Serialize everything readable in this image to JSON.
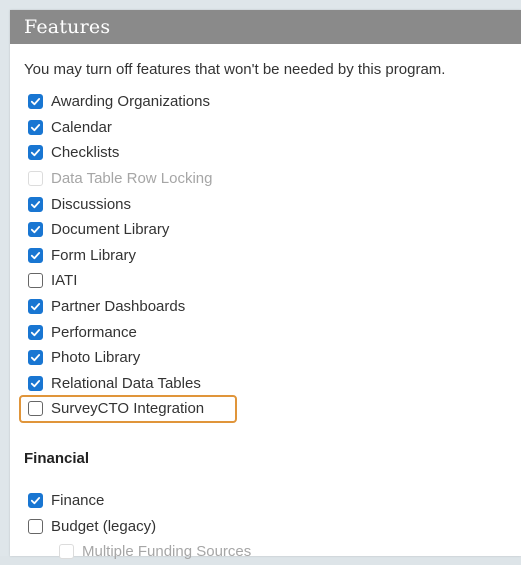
{
  "panel": {
    "title": "Features",
    "intro": "You may turn off features that won't be needed by this program."
  },
  "features": [
    {
      "label": "Awarding Organizations",
      "state": "checked"
    },
    {
      "label": "Calendar",
      "state": "checked"
    },
    {
      "label": "Checklists",
      "state": "checked"
    },
    {
      "label": "Data Table Row Locking",
      "state": "disabled"
    },
    {
      "label": "Discussions",
      "state": "checked"
    },
    {
      "label": "Document Library",
      "state": "checked"
    },
    {
      "label": "Form Library",
      "state": "checked"
    },
    {
      "label": "IATI",
      "state": "unchecked"
    },
    {
      "label": "Partner Dashboards",
      "state": "checked"
    },
    {
      "label": "Performance",
      "state": "checked"
    },
    {
      "label": "Photo Library",
      "state": "checked"
    },
    {
      "label": "Relational Data Tables",
      "state": "checked"
    },
    {
      "label": "SurveyCTO Integration",
      "state": "unchecked",
      "highlighted": true
    }
  ],
  "financial": {
    "title": "Financial",
    "items": [
      {
        "label": "Finance",
        "state": "checked"
      },
      {
        "label": "Budget (legacy)",
        "state": "unchecked"
      },
      {
        "label": "Multiple Funding Sources",
        "state": "disabled",
        "sub": true
      }
    ]
  },
  "colors": {
    "checkbox_accent": "#1976d2",
    "header_bg": "#8a8a8a",
    "highlight_border": "#e0953a"
  },
  "icons": {
    "checked": "checkmark-icon"
  }
}
